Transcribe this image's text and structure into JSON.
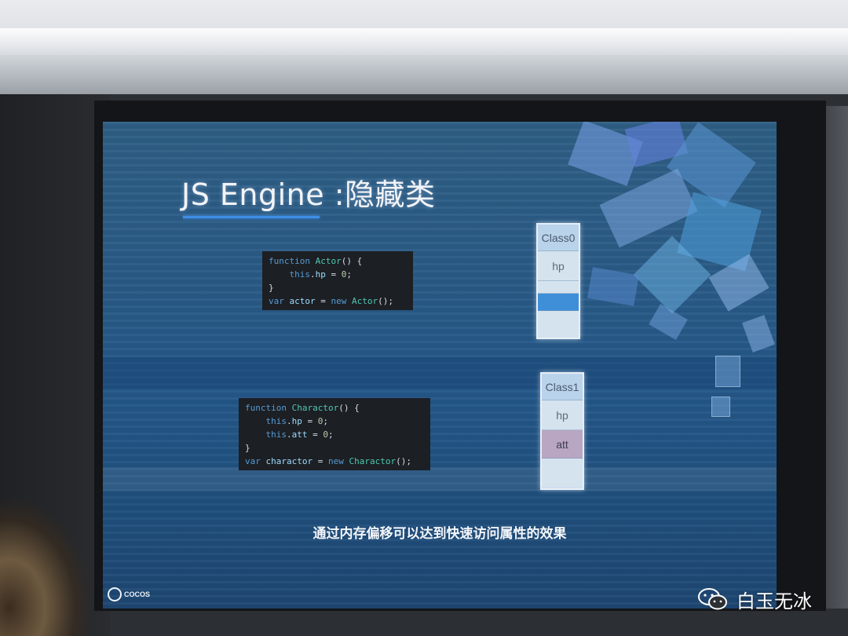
{
  "slide": {
    "title": "JS Engine :隐藏类",
    "code_block_1": [
      "function Actor() {",
      "    this.hp = 0;",
      "}",
      "var actor = new Actor();"
    ],
    "code_block_2": [
      "function Charactor() {",
      "    this.hp = 0;",
      "    this.att = 0;",
      "}",
      "var charactor = new Charactor();"
    ],
    "class_box_1": {
      "header": "Class0",
      "fields": [
        "hp"
      ]
    },
    "class_box_2": {
      "header": "Class1",
      "fields": [
        "hp",
        "att"
      ]
    },
    "subtitle": "通过内存偏移可以达到快速访问属性的效果",
    "logo_text": "COCOS"
  },
  "watermark": {
    "text": "白玉无冰",
    "icon": "wechat-icon"
  }
}
